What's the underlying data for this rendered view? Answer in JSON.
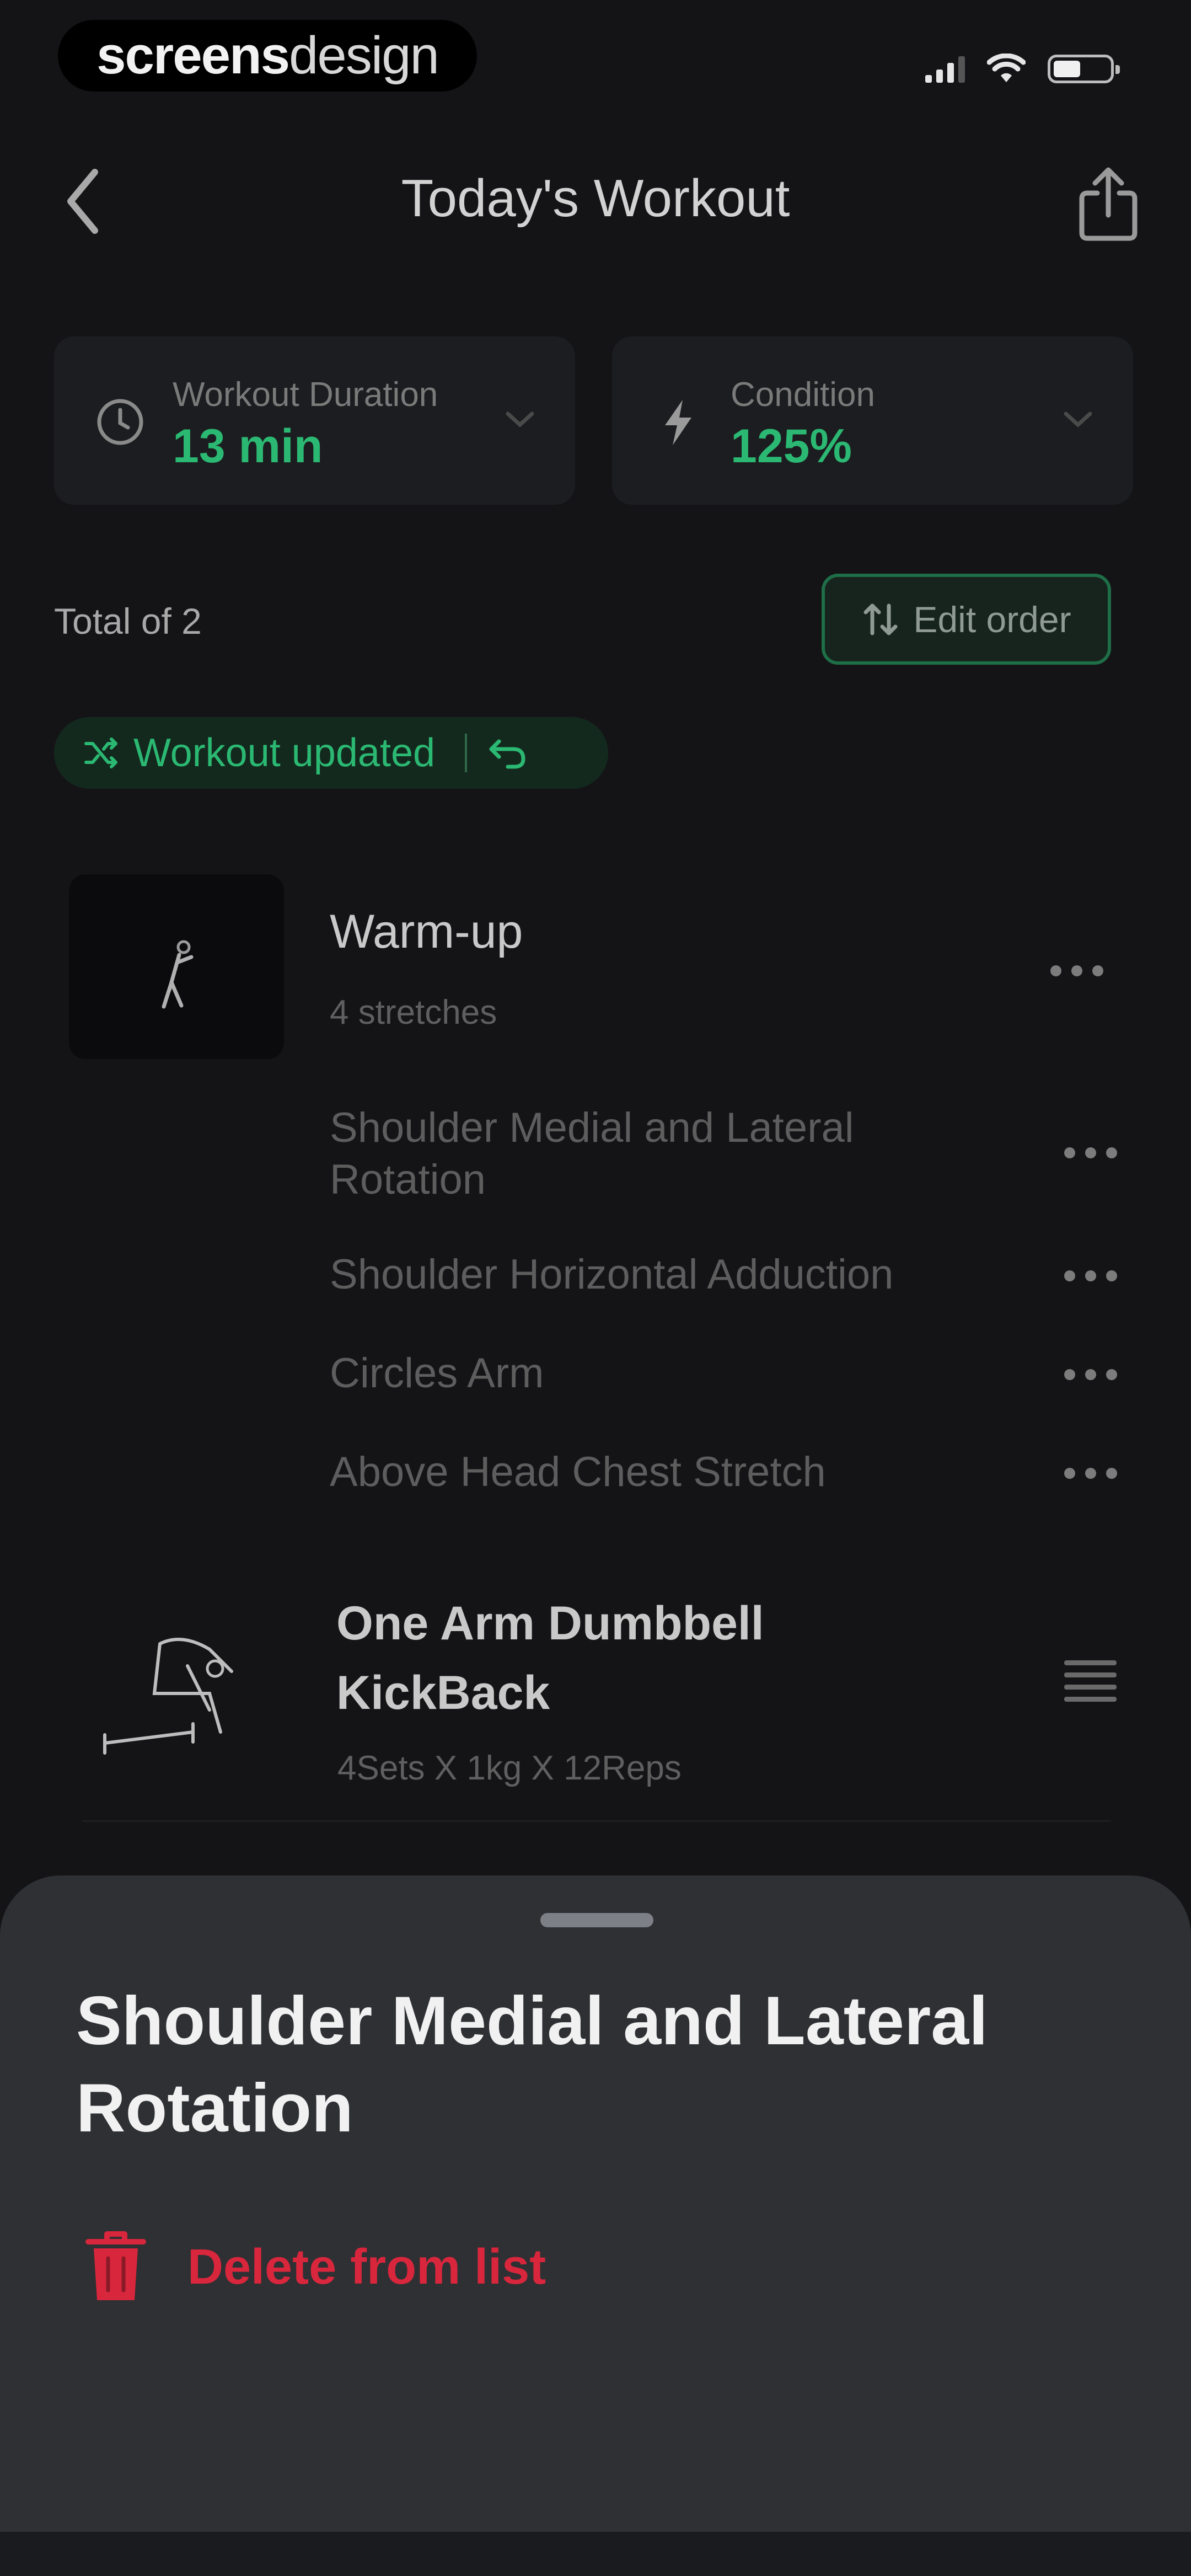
{
  "status_bar": {
    "brand_bold": "screens",
    "brand_light": "design"
  },
  "header": {
    "title": "Today's Workout"
  },
  "stats": [
    {
      "label": "Workout Duration",
      "value": "13 min",
      "icon": "clock-icon"
    },
    {
      "label": "Condition",
      "value": "125%",
      "icon": "lightning-icon"
    }
  ],
  "list_meta": {
    "total": "Total of 2",
    "edit_order": "Edit order"
  },
  "banner": {
    "text": "Workout updated"
  },
  "warmup": {
    "title": "Warm-up",
    "subtitle": "4 stretches",
    "stretches": [
      "Shoulder Medial and Lateral Rotation",
      "Shoulder Horizontal Adduction",
      "Circles Arm",
      "Above Head Chest Stretch"
    ]
  },
  "exercise": {
    "title": "One Arm Dumbbell KickBack",
    "subtitle": "4Sets X 1kg X 12Reps"
  },
  "sheet": {
    "title": "Shoulder Medial and Lateral Rotation",
    "delete_label": "Delete from list"
  },
  "colors": {
    "accent": "#2bb872",
    "danger": "#d8263c",
    "sheet_bg": "#2e3034",
    "background": "#141417"
  }
}
